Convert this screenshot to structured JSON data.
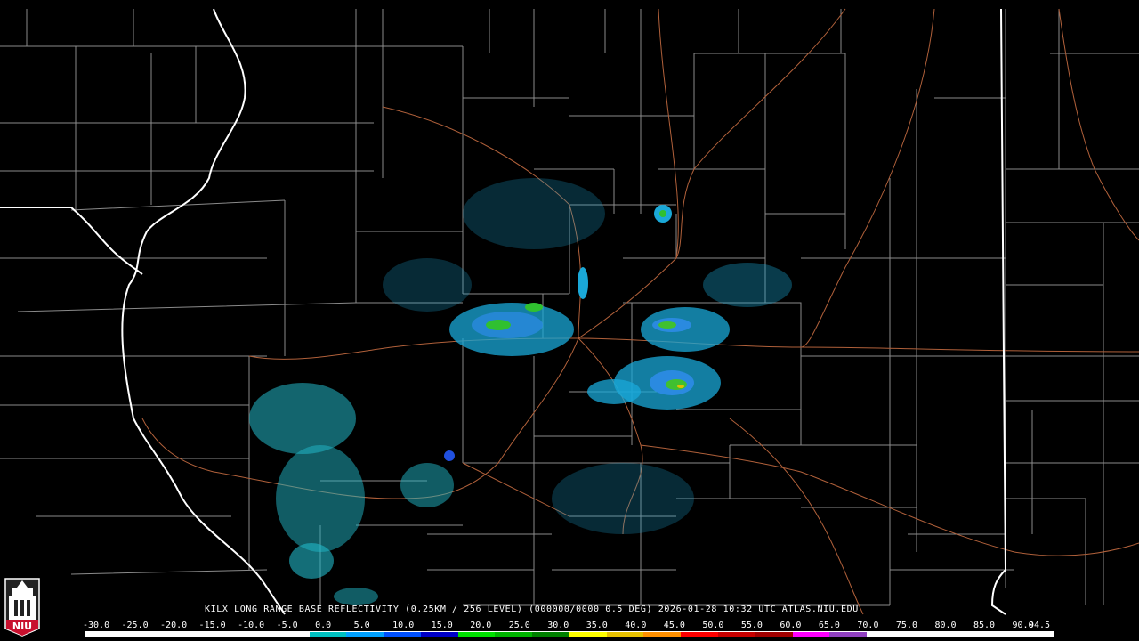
{
  "map": {
    "title": "KILX LONG RANGE BASE REFLECTIVITY (0.25KM / 256 LEVEL) (000000/0000 0.5 DEG) 2026-01-28 10:32 UTC  ATLAS.NIU.EDU",
    "logo_text": "NIU",
    "background_color": "#000000",
    "state_border_color": "#ffffff",
    "county_border_color": "#8a8a8a",
    "highway_color": "#b0603a"
  },
  "legend": {
    "ticks": [
      "-30.0",
      "-25.0",
      "-20.0",
      "-15.0",
      "-10.0",
      "-5.0",
      "0.0",
      "5.0",
      "10.0",
      "15.0",
      "20.0",
      "25.0",
      "30.0",
      "35.0",
      "40.0",
      "45.0",
      "50.0",
      "55.0",
      "60.0",
      "65.0",
      "70.0",
      "75.0",
      "80.0",
      "85.0",
      "90.0",
      "94.5"
    ],
    "colors": [
      "#ffffff",
      "#ffffff",
      "#ffffff",
      "#ffffff",
      "#ffffff",
      "#ffffff",
      "#00c0c0",
      "#00a0ff",
      "#0050ff",
      "#0000c8",
      "#00e000",
      "#00b400",
      "#008000",
      "#ffff00",
      "#e6c000",
      "#ff9000",
      "#ff0000",
      "#c80000",
      "#a00000",
      "#ff00ff",
      "#9040c0",
      "#ffffff",
      "#ffffff",
      "#ffffff",
      "#ffffff",
      "#ffffff"
    ]
  }
}
